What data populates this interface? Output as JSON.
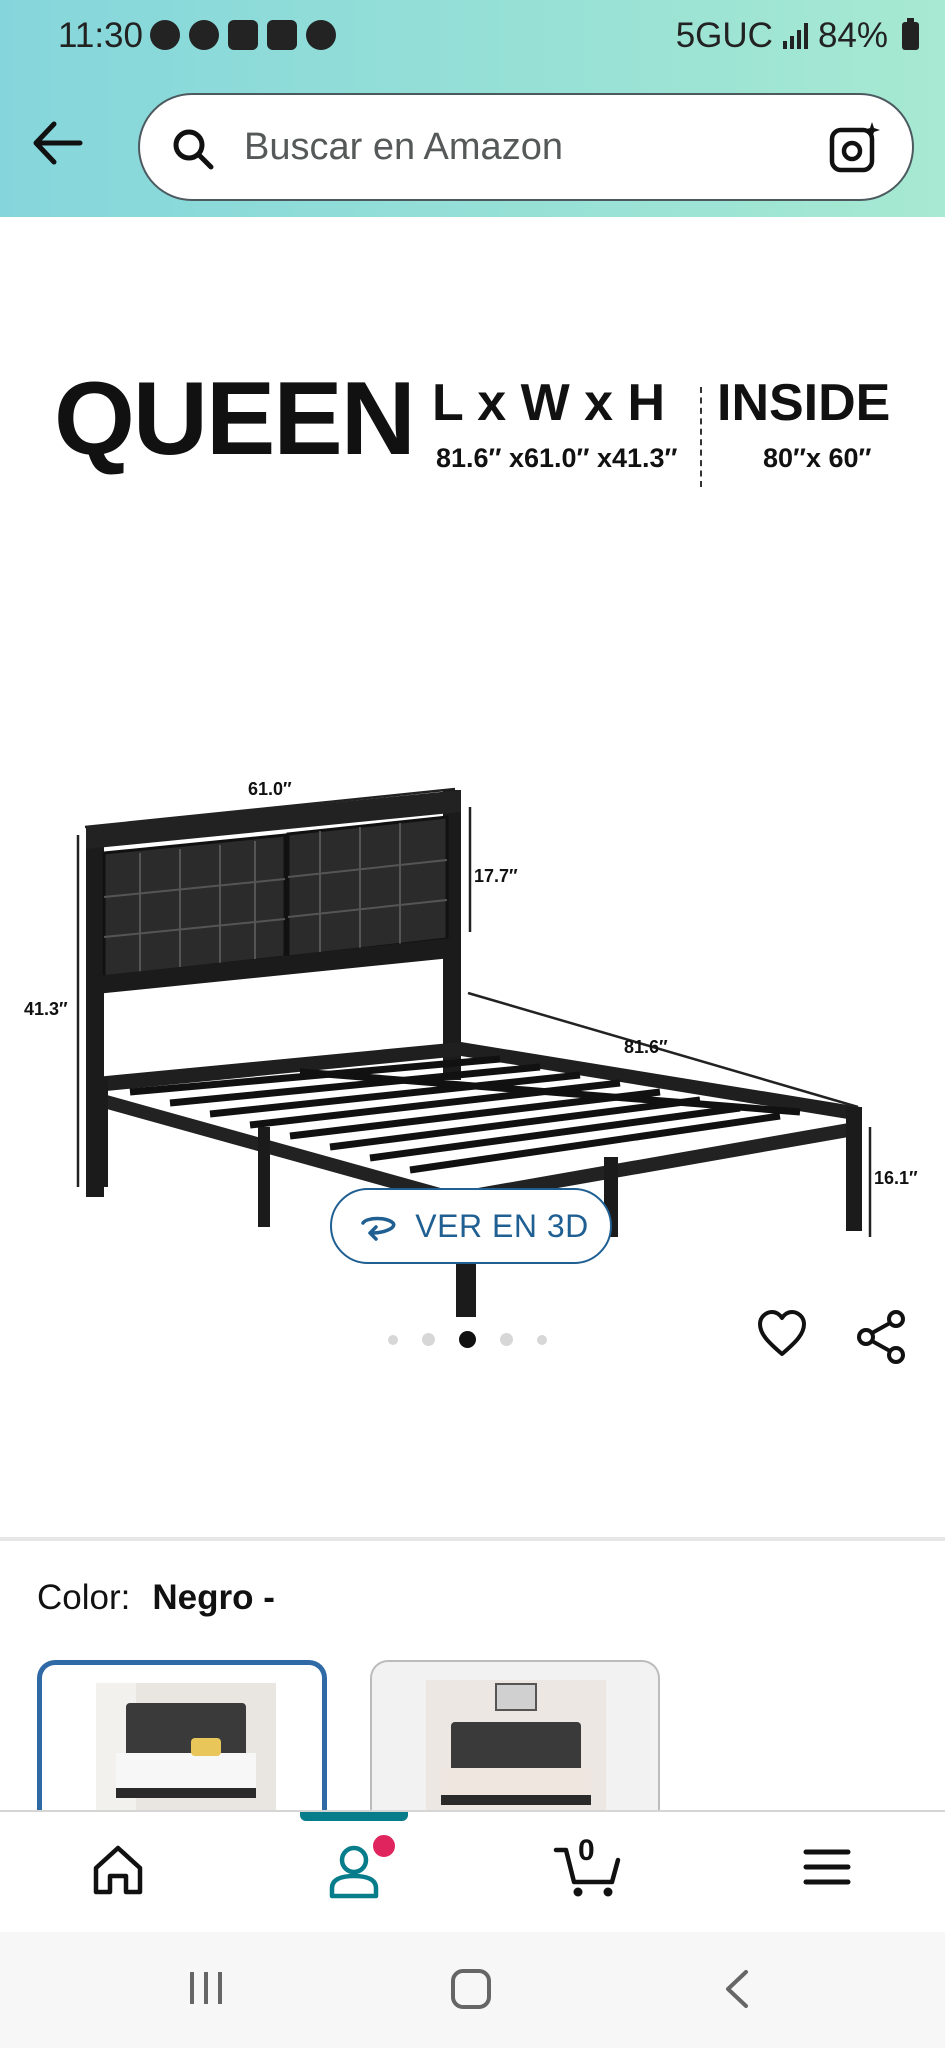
{
  "status_bar": {
    "time": "11:30",
    "network": "5GUC",
    "battery": "84%"
  },
  "search": {
    "placeholder": "Buscar en Amazon"
  },
  "product_image": {
    "size_title": "QUEEN",
    "dimensions_label": "L x W x H",
    "dimensions_value": "81.6″ x61.0″ x41.3″",
    "inside_label": "INSIDE",
    "inside_value": "80″x 60″",
    "width_label": "61.0″",
    "headboard_height_label": "17.7″",
    "total_height_label": "41.3″",
    "length_label": "81.6″",
    "clearance_label": "16.1″"
  },
  "carousel": {
    "count": 5,
    "active_index": 2
  },
  "view_3d": {
    "label": "VER EN 3D"
  },
  "variation": {
    "label": "Color:",
    "value": "Negro -"
  },
  "bottom_nav": {
    "cart_count": "0"
  },
  "colors": {
    "header_start": "#85d6dc",
    "header_end": "#a7e9d2",
    "accent_blue": "#1f5f92",
    "nav_teal": "#077c8a",
    "badge": "#e0245e"
  }
}
